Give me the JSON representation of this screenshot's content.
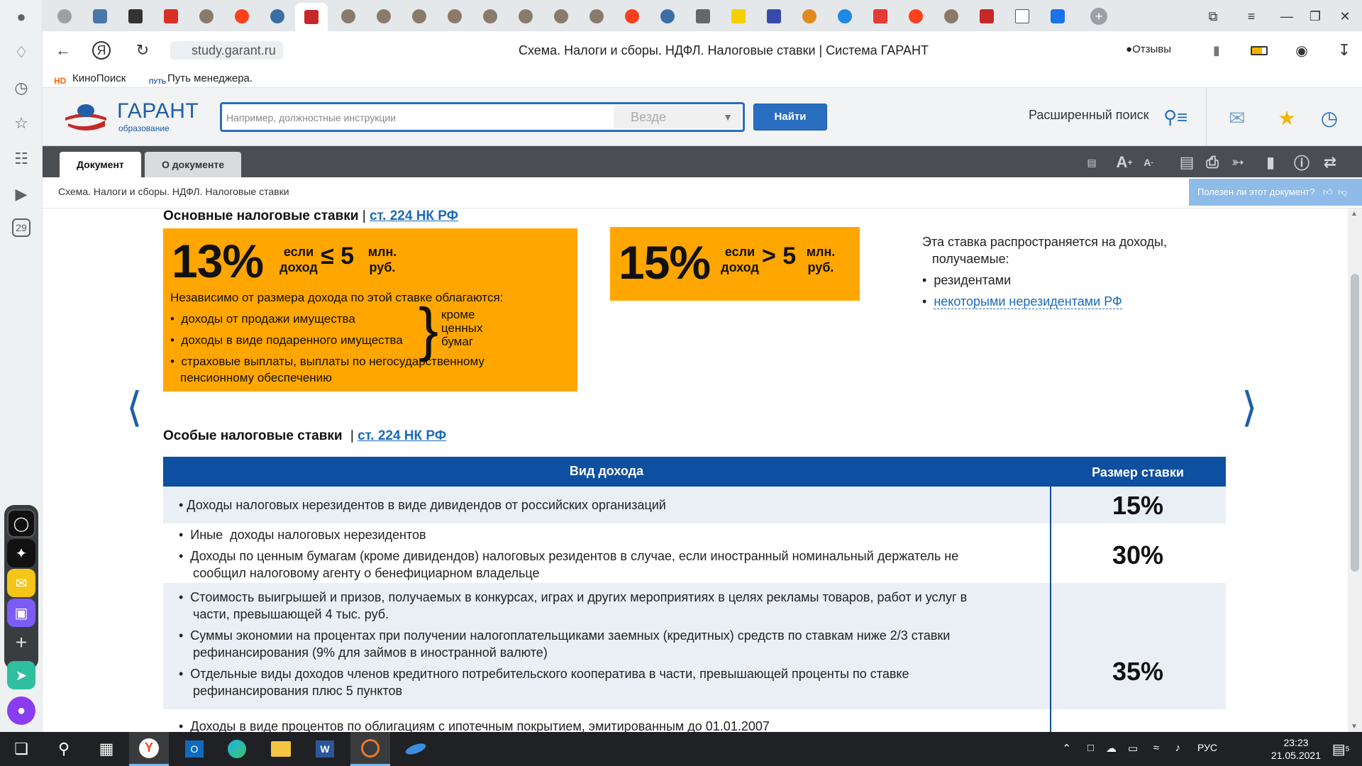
{
  "browser": {
    "url_domain": "study.garant.ru",
    "page_title": "Схема. Налоги и сборы. НДФЛ. Налоговые ставки | Система ГАРАНТ",
    "reviews_label": "Отзывы",
    "bookmarks": [
      {
        "label": "КиноПоиск",
        "icon": "kinopoisk-icon"
      },
      {
        "label": "Путь менеджера.",
        "icon": "put-menedzhera-icon"
      }
    ],
    "sidebar_badge": "29"
  },
  "garant": {
    "logo_text": "ГАРАНТ",
    "logo_sub": "образование",
    "search_placeholder": "Например, должностные инструкции",
    "search_scope": "Везде",
    "search_button": "Найти",
    "advanced_search": "Расширенный поиск",
    "tabs": [
      "Документ",
      "О документе"
    ],
    "breadcrumb": "Схема. Налоги и сборы. НДФЛ. Налоговые ставки",
    "useful_prompt": "Полезен ли этот документ?"
  },
  "content": {
    "basic": {
      "title": "Основные налоговые ставки",
      "sep": "|",
      "link": "ст. 224 НК РФ",
      "rate13": {
        "rate": "13%",
        "cond_top": "если",
        "cond_bottom": "доход",
        "sign": "≤ 5",
        "unit_top": "млн.",
        "unit_bottom": "руб."
      },
      "intro": "Независимо от размера дохода по этой ставке облагаются:",
      "items": [
        "доходы от продажи имущества",
        "доходы в виде подаренного имущества",
        "страховые выплаты, выплаты по негосударственному",
        "пенсионному обеспечению"
      ],
      "except": [
        "кроме",
        "ценных",
        "бумаг"
      ],
      "rate15": {
        "rate": "15%",
        "cond_top": "если",
        "cond_bottom": "доход",
        "sign": "> 5",
        "unit_top": "млн.",
        "unit_bottom": "руб."
      },
      "note_line1": "Эта ставка распространяется на доходы,",
      "note_line2": "получаемые:",
      "note_item1": "резидентами",
      "note_item2": "некоторыми нерезидентами РФ"
    },
    "special": {
      "title": "Особые налоговые ставки",
      "sep": "|",
      "link": "ст. 224 НК РФ",
      "col_kind": "Вид дохода",
      "col_rate": "Размер ставки",
      "row1": [
        "• Доходы налоговых нерезидентов в виде дивидендов от российских организаций"
      ],
      "row1_rate": "15%",
      "row2": [
        "•  Иные  доходы налоговых нерезидентов",
        "•  Доходы по ценным бумагам (кроме дивидендов) налоговых резидентов в случае, если иностранный номинальный держатель не",
        "    сообщил налоговому агенту о бенефициарном владельце"
      ],
      "row2_rate": "30%",
      "row3": [
        "•  Стоимость выигрышей и призов, получаемых в конкурсах, играх и других мероприятиях в целях рекламы товаров, работ и услуг в",
        "    части, превышающей 4 тыс. руб.",
        "•  Суммы экономии на процентах при получении налогоплательщиками заемных (кредитных) средств по ставкам ниже 2/3 ставки",
        "    рефинансирования (9% для займов в иностранной валюте)",
        "•  Отдельные виды доходов членов кредитного потребительского кооператива в части, превышающей проценты по ставке",
        "    рефинансирования плюс 5 пунктов"
      ],
      "row3_rate": "35%",
      "row4": [
        "•  Доходы в виде процентов по облигациям с ипотечным покрытием, эмитированным до 01.01.2007"
      ]
    }
  },
  "taskbar": {
    "lang": "РУС",
    "time": "23:23",
    "date": "21.05.2021",
    "notif_count": "5"
  },
  "colors": {
    "orange": "#ffa600",
    "brand_blue": "#1f5ea8",
    "table_header": "#0d4fa0",
    "link": "#1a6bb8"
  }
}
